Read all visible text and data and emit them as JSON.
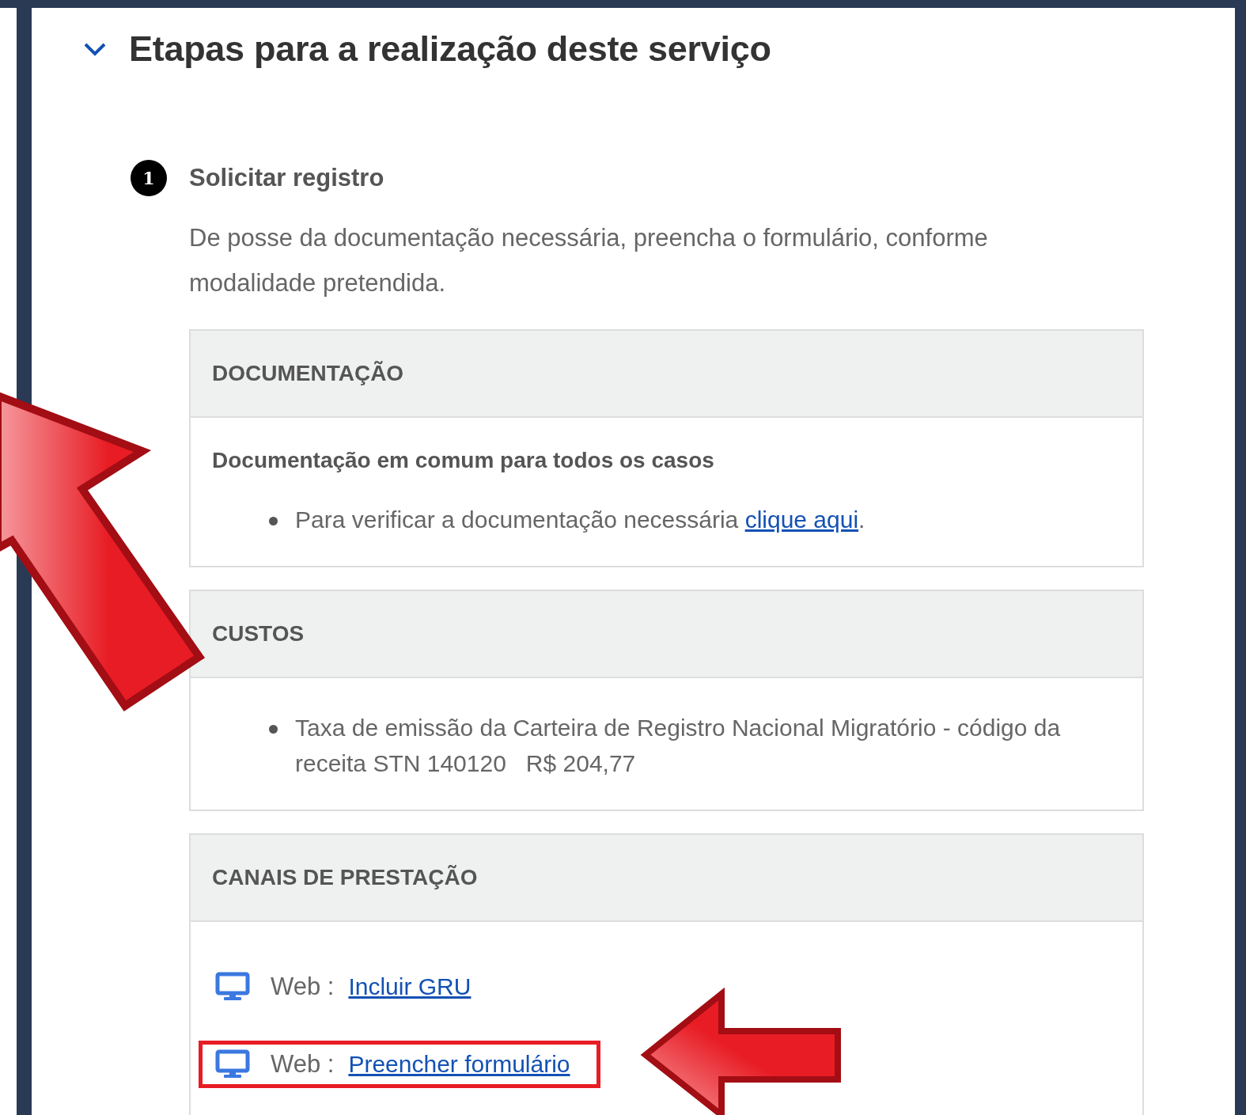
{
  "section": {
    "title": "Etapas para a realização deste serviço",
    "expanded": true
  },
  "steps": [
    {
      "number": "1",
      "title": "Solicitar registro",
      "description": "De posse da documentação necessária, preencha o formulário, conforme modalidade pretendida.",
      "panels": [
        {
          "kind": "list",
          "heading": "DOCUMENTAÇÃO",
          "subheading": "Documentação em comum para todos os casos",
          "items": [
            {
              "text": "Para verificar a documentação necessária ",
              "link": "clique aqui",
              "suffix": "."
            }
          ]
        },
        {
          "kind": "list",
          "heading": "CUSTOS",
          "items": [
            {
              "text": "Taxa de emissão da Carteira de Registro Nacional Migratório - código da receita STN 140120   R$ 204,77"
            }
          ]
        },
        {
          "kind": "channels",
          "heading": "CANAIS DE PRESTAÇÃO",
          "channels": [
            {
              "label": "Web :",
              "link": "Incluir GRU",
              "highlighted": false
            },
            {
              "label": "Web :",
              "link": "Preencher formulário",
              "highlighted": true
            }
          ]
        }
      ]
    }
  ]
}
